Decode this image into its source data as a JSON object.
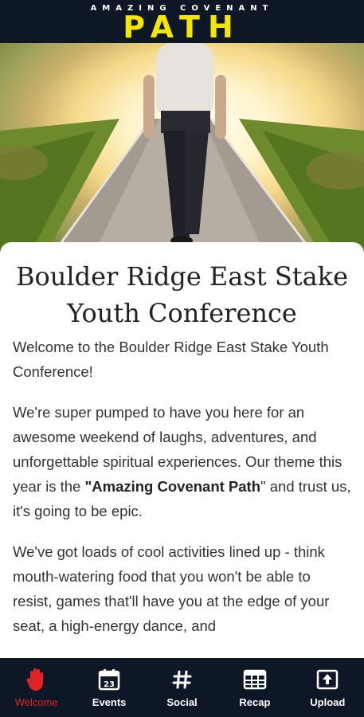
{
  "header": {
    "sup_text": "AMAZING COVENANT",
    "main_text": "PATH"
  },
  "article": {
    "title": "Boulder Ridge East Stake Youth Conference",
    "intro": "Welcome to the Boulder Ridge East Stake Youth Conference!",
    "p2_before": "We're super pumped to have you here for an awesome weekend of laughs, adventures, and unforgettable spiritual experiences. Our theme this year is the ",
    "p2_bold": "\"Amazing Covenant Path",
    "p2_after": "\" and trust us, it's going to be epic.",
    "p3": "We've got loads of cool activities lined up - think mouth-watering food that you won't be able to resist, games that'll have you at the edge of your seat, a high-energy dance, and"
  },
  "tabs": [
    {
      "label": "Welcome",
      "icon": "hand-icon"
    },
    {
      "label": "Events",
      "icon": "calendar-icon"
    },
    {
      "label": "Social",
      "icon": "hashtag-icon"
    },
    {
      "label": "Recap",
      "icon": "table-icon"
    },
    {
      "label": "Upload",
      "icon": "upload-icon"
    }
  ],
  "calendar_day": "23",
  "colors": {
    "header_bg": "#0e1726",
    "brand_yellow": "#f3e600",
    "active_tab": "#e02424"
  }
}
